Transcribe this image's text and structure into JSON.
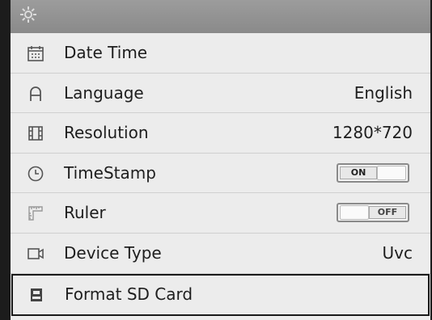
{
  "header": {
    "icon": "gear-icon"
  },
  "rows": [
    {
      "label": "Date Time",
      "icon": "calendar-icon",
      "value": ""
    },
    {
      "label": "Language",
      "icon": "language-icon",
      "value": "English"
    },
    {
      "label": "Resolution",
      "icon": "film-icon",
      "value": "1280*720"
    },
    {
      "label": "TimeStamp",
      "icon": "clock-icon",
      "toggle": "ON"
    },
    {
      "label": "Ruler",
      "icon": "ruler-icon",
      "toggle": "OFF"
    },
    {
      "label": "Device Type",
      "icon": "camera-icon",
      "value": "Uvc"
    },
    {
      "label": "Format SD Card",
      "icon": "sd-card-icon",
      "value": "",
      "selected": true
    }
  ]
}
